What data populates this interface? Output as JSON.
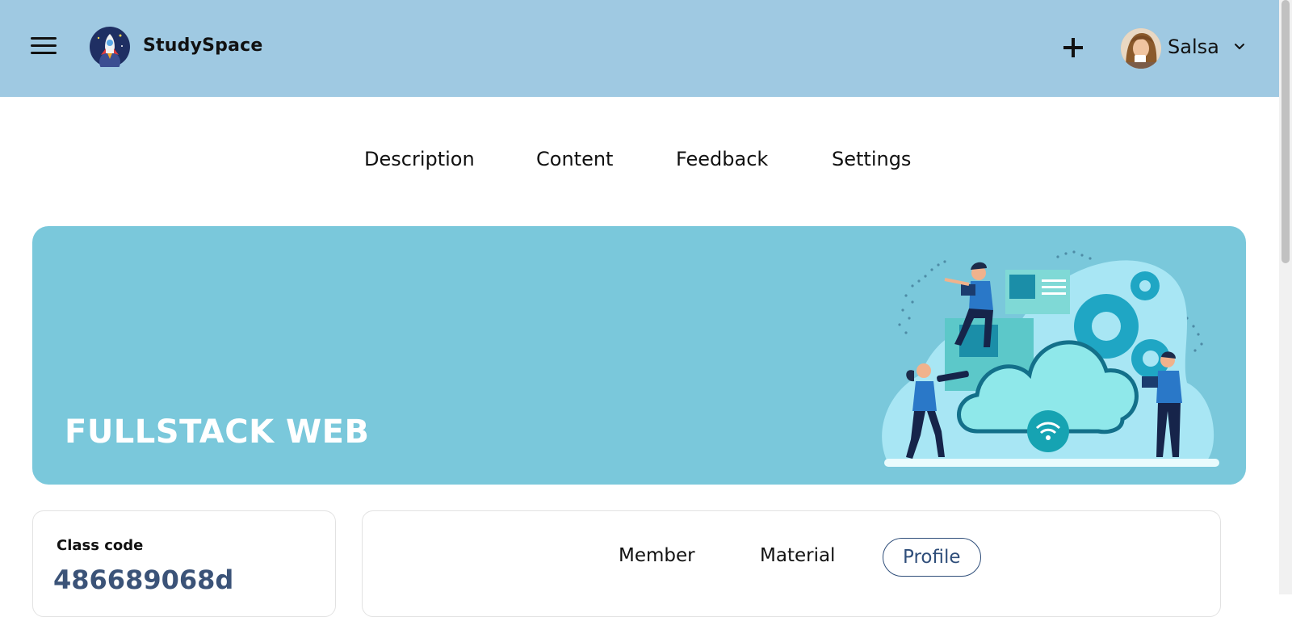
{
  "header": {
    "brand": "StudySpace",
    "username": "Salsa",
    "icons": [
      "menu-icon",
      "rocket-logo",
      "plus-icon",
      "chevron-down-icon"
    ]
  },
  "tabs": [
    {
      "label": "Description"
    },
    {
      "label": "Content"
    },
    {
      "label": "Feedback"
    },
    {
      "label": "Settings"
    }
  ],
  "banner": {
    "title": "FULLSTACK WEB",
    "color": "#7ac8db"
  },
  "class_info": {
    "label": "Class code",
    "code": "486689068d"
  },
  "sub_tabs": [
    {
      "label": "Member",
      "active": false
    },
    {
      "label": "Material",
      "active": false
    },
    {
      "label": "Profile",
      "active": true
    }
  ],
  "colors": {
    "header_bg": "#9fc9e2",
    "accent": "#2f4e7a"
  }
}
